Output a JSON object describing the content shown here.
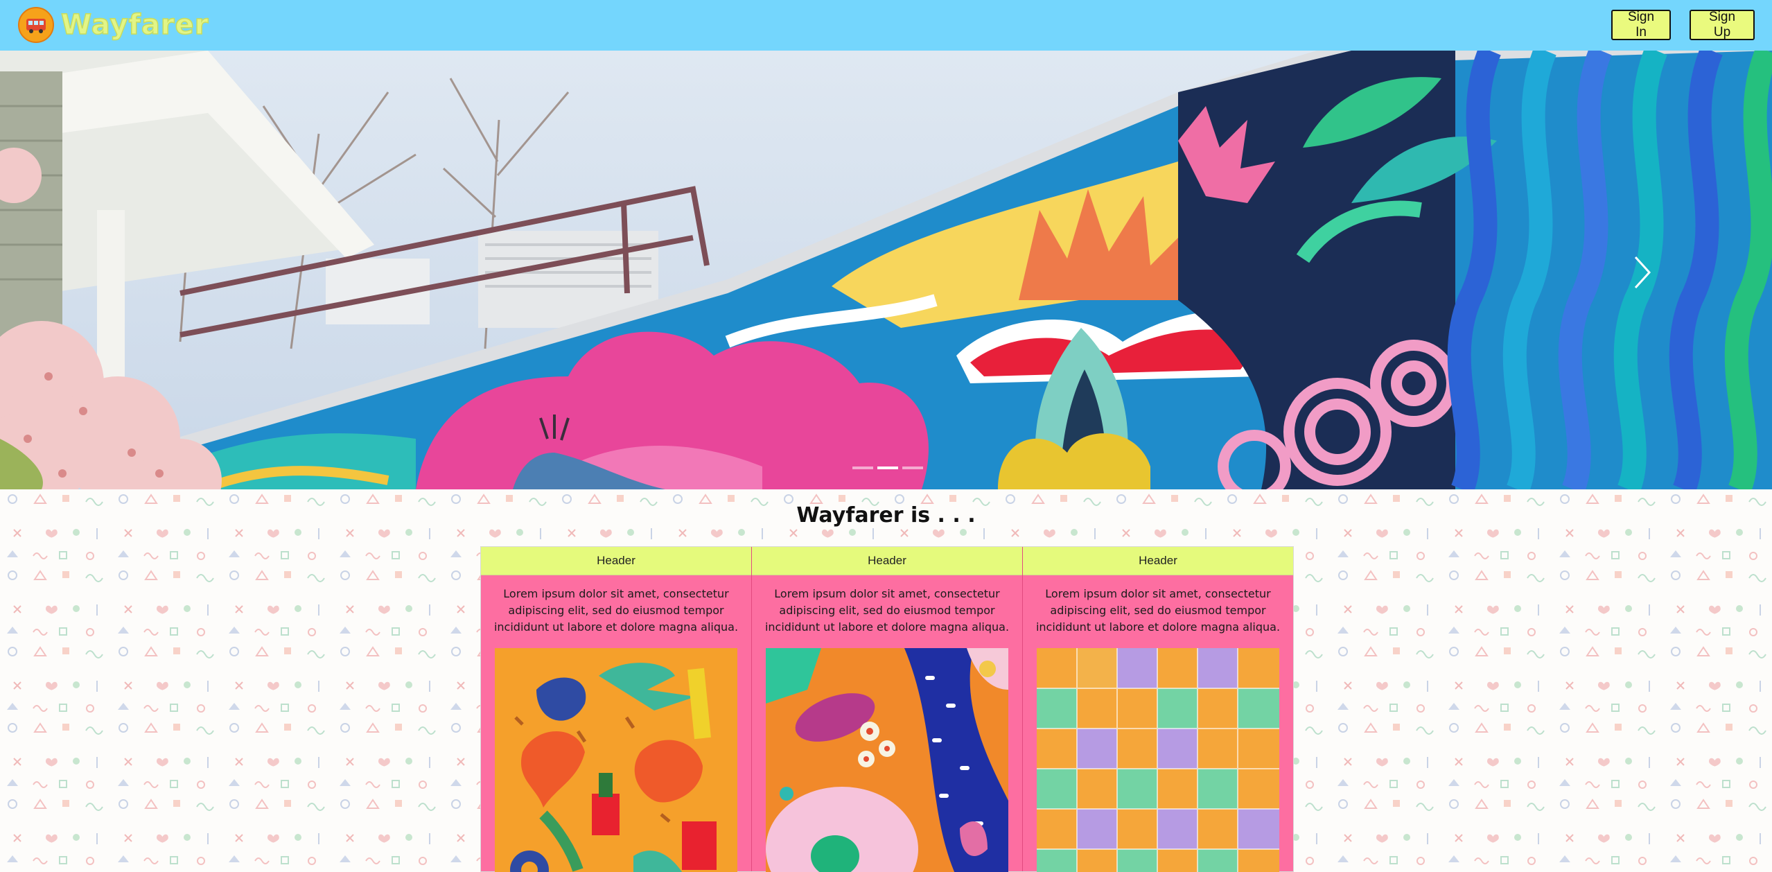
{
  "brand": {
    "name": "Wayfarer",
    "logo_icon": "bus-icon"
  },
  "nav": {
    "sign_in": "Sign In",
    "sign_up": "Sign Up"
  },
  "carousel": {
    "slides": 3,
    "active_slide": 2,
    "next_icon": "chevron-right-icon"
  },
  "section": {
    "title": "Wayfarer is . . ."
  },
  "cards": [
    {
      "header": "Header",
      "text": "Lorem ipsum dolor sit amet, consectetur adipiscing elit, sed do eiusmod tempor incididunt ut labore et dolore magna aliqua."
    },
    {
      "header": "Header",
      "text": "Lorem ipsum dolor sit amet, consectetur adipiscing elit, sed do eiusmod tempor incididunt ut labore et dolore magna aliqua."
    },
    {
      "header": "Header",
      "text": "Lorem ipsum dolor sit amet, consectetur adipiscing elit, sed do eiusmod tempor incididunt ut labore et dolore magna aliqua."
    }
  ],
  "colors": {
    "navbar": "#74d6fd",
    "button": "#eafa7e",
    "card_header": "#e5fa7c",
    "card_body": "#fd6ea1"
  }
}
